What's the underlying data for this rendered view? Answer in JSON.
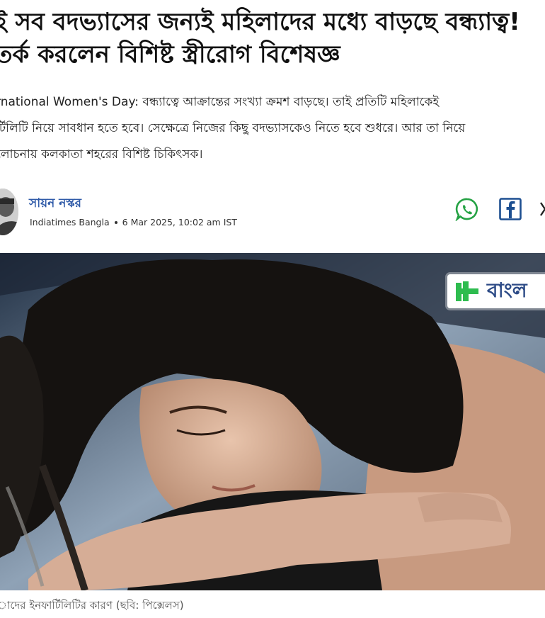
{
  "article": {
    "headline_line1": "ই সব বদভ্যাসের জন্যই মহিলাদের মধ্যে বাড়ছে বন্ধ্যাত্ব!",
    "headline_line2": "তর্ক করলেন বিশিষ্ট স্ত্রীরোগ বিশেষজ্ঞ",
    "summary_line1": "rnational Women's Day: বন্ধ্যাত্বে আক্রান্তের সংখ্যা ক্রমশ বাড়ছে। তাই প্রতিটি মহিলাকেই",
    "summary_line2": "র্টিলিটি নিয়ে সাবধান হতে হবে। সেক্ষেত্রে নিজের কিছু বদভ্যাসকেও নিতে হবে শুধরে। আর তা নিয়ে",
    "summary_line3": "লোচনায় কলকাতা শহরের বিশিষ্ট চিকিৎসক।"
  },
  "byline": {
    "author": "সায়ন নস্কর",
    "publication": "Indiatimes Bangla",
    "timestamp": "6 Mar 2025, 10:02 am IST"
  },
  "share": {
    "whatsapp_icon": "whatsapp-icon",
    "facebook_icon": "facebook-icon",
    "x_icon": "x-icon"
  },
  "hero": {
    "badge_text": "বাংল"
  },
  "caption": "াদের ইনফার্টিলিটির কারণ (ছবি: পিক্সেলস)",
  "colors": {
    "author_link": "#2f5aa8",
    "whatsapp": "#25a244",
    "facebook": "#1d4f91",
    "badge_green": "#2ebc4f",
    "badge_text": "#2c4a86"
  }
}
